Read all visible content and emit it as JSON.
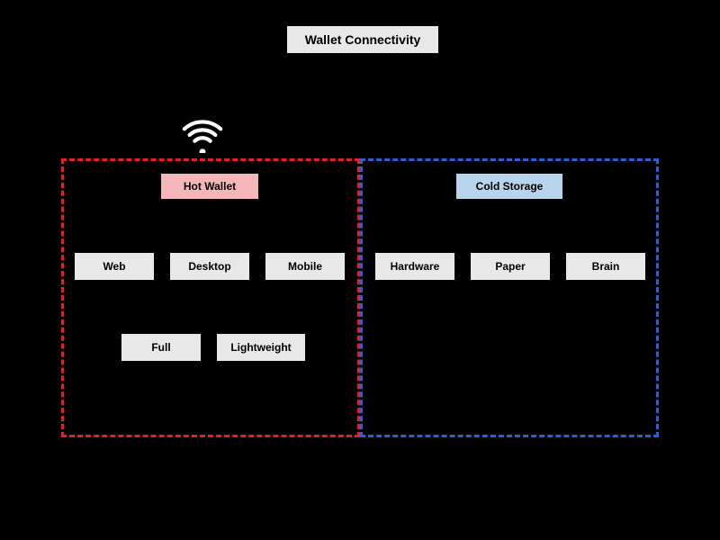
{
  "title": "Wallet Connectivity",
  "hot": {
    "header": "Hot Wallet",
    "items_row1": [
      "Web",
      "Desktop",
      "Mobile"
    ],
    "items_row2": [
      "Full",
      "Lightweight"
    ]
  },
  "cold": {
    "header": "Cold Storage",
    "items": [
      "Hardware",
      "Paper",
      "Brain"
    ]
  }
}
